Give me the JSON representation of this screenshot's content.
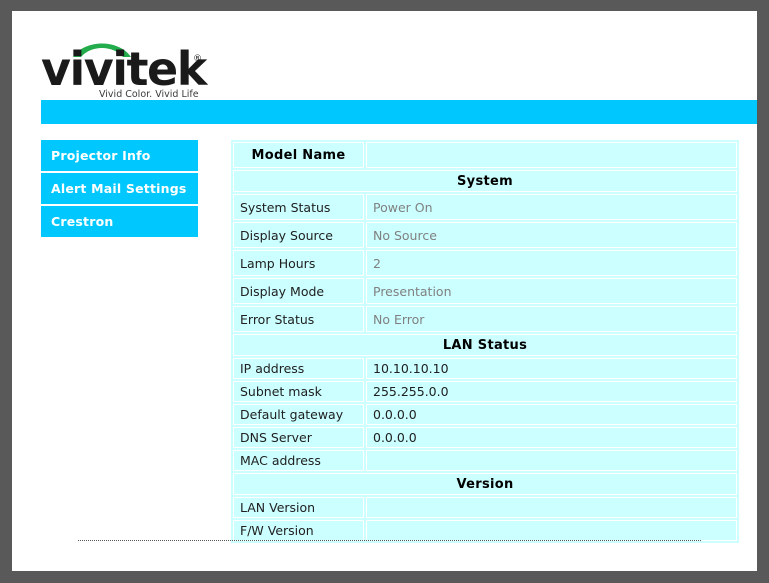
{
  "brand": {
    "logo_text": "vivitek",
    "logo_registered_mark": "®",
    "tagline": "Vivid Color. Vivid Life",
    "logo_arc_color": "#22ac4b",
    "logo_text_color": "#1a1a1a"
  },
  "colors": {
    "accent_cyan": "#00c8ff",
    "table_cell": "#ccffff",
    "page_background": "#ffffff",
    "frame_gray": "#595959",
    "value_gray": "#808080"
  },
  "sidebar": {
    "items": [
      {
        "label": "Projector Info"
      },
      {
        "label": "Alert Mail Settings"
      },
      {
        "label": "Crestron"
      }
    ]
  },
  "table": {
    "model_name_label": "Model Name",
    "model_name_value": "",
    "sections": [
      {
        "title": "System",
        "rows": [
          {
            "label": "System Status",
            "value": "Power On"
          },
          {
            "label": "Display Source",
            "value": "No Source"
          },
          {
            "label": "Lamp Hours",
            "value": "2"
          },
          {
            "label": "Display Mode",
            "value": "Presentation"
          },
          {
            "label": "Error Status",
            "value": "No Error"
          }
        ]
      },
      {
        "title": "LAN Status",
        "rows": [
          {
            "label": "IP address",
            "value": "10.10.10.10"
          },
          {
            "label": "Subnet mask",
            "value": "255.255.0.0"
          },
          {
            "label": "Default gateway",
            "value": "0.0.0.0"
          },
          {
            "label": "DNS Server",
            "value": "0.0.0.0"
          },
          {
            "label": "MAC address",
            "value": ""
          }
        ]
      },
      {
        "title": "Version",
        "rows": [
          {
            "label": "LAN Version",
            "value": ""
          },
          {
            "label": "F/W Version",
            "value": ""
          }
        ]
      }
    ]
  }
}
